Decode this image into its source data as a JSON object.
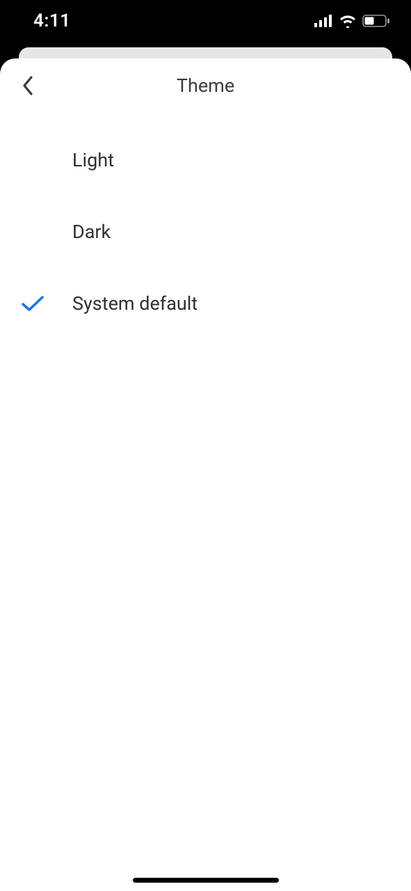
{
  "status": {
    "time": "4:11"
  },
  "header": {
    "title": "Theme"
  },
  "options": [
    {
      "label": "Light",
      "selected": false
    },
    {
      "label": "Dark",
      "selected": false
    },
    {
      "label": "System default",
      "selected": true
    }
  ],
  "colors": {
    "accent": "#1a73e8"
  }
}
